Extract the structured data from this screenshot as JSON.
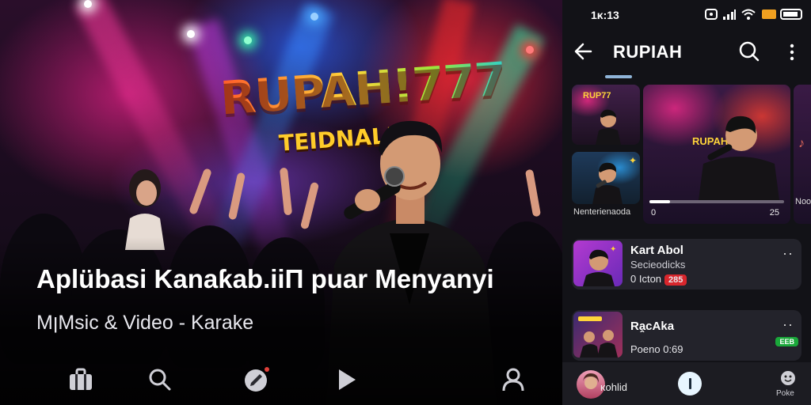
{
  "hero": {
    "logo_text": "RUPAH!777",
    "logo_sub": "TEIDNAL!!K!",
    "title": "Aplübasi Kanaƙab.iiΠ puar Menyanyi",
    "subtitle": "MןMsic & Video - Karake",
    "nav_icons": [
      "briefcase-icon",
      "search-icon",
      "edit-badge-icon",
      "play-icon",
      "profile-icon"
    ]
  },
  "phone": {
    "status_time": "1ᴋ:13",
    "status_icons": [
      "nfc-icon",
      "signal-icon",
      "wifi-icon",
      "battery-icon"
    ],
    "appbar": {
      "title": "RUPIAH"
    },
    "carousel": {
      "thumb_badge": "RUP77",
      "small_label": "Nenterienaoda",
      "featured_logo": "RUPAH",
      "featured_time_left": "0",
      "featured_time_right": "25",
      "featured_progress": 0.15,
      "edge_label": "Noo"
    },
    "list": [
      {
        "title": "Kart Abol",
        "subtitle": "Secieodicks",
        "meta": "0 Icton",
        "badge": "285",
        "badge_color": "#d8262c"
      },
      {
        "title": "Ra̭cAka",
        "subtitle": "Poeno",
        "meta": "0:69",
        "badge": "EEB",
        "badge_color": "#1aa83a"
      }
    ],
    "mini_player": {
      "label": "ᴋohlid",
      "right_label": "Poke"
    },
    "colors": {
      "accent": "#8fb4d8",
      "card": "#23232b"
    }
  }
}
